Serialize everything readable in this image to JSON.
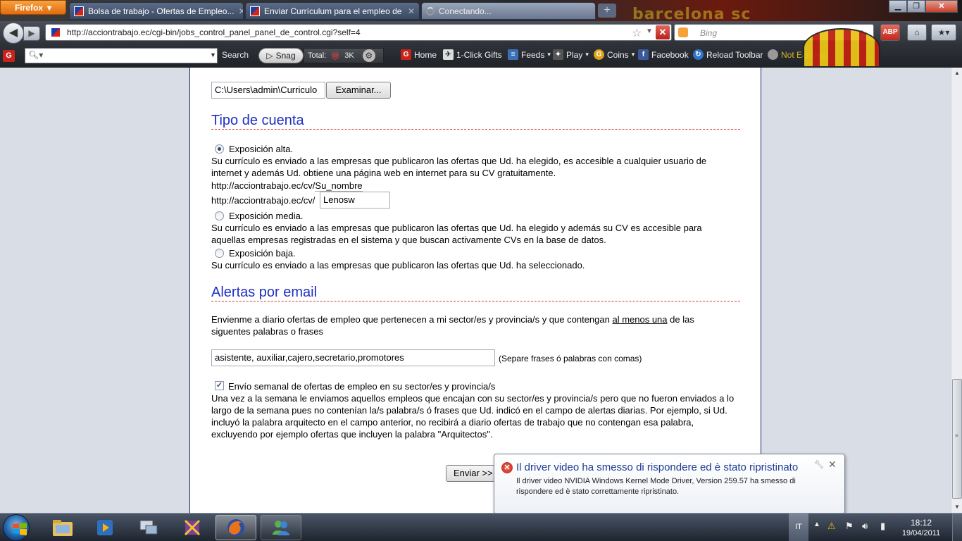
{
  "browser": {
    "menu_button": "Firefox",
    "tabs": [
      {
        "title": "Bolsa de trabajo - Ofertas de Empleo...",
        "state": "inactive"
      },
      {
        "title": "Enviar Currículum para el empleo de",
        "state": "inactive"
      },
      {
        "title": "Conectando...",
        "state": "active"
      }
    ],
    "url": "http://acciontrabajo.ec/cgi-bin/jobs_control_panel_panel_de_control.cgi?self=4",
    "search_placeholder": "Bing",
    "brand_watermark": "barcelona sc"
  },
  "toolbar": {
    "search_label": "Search",
    "snag_label": "Snag",
    "total_label": "Total:",
    "total_count": "3K",
    "items": [
      {
        "label": "Home",
        "icon": "g-icon"
      },
      {
        "label": "1-Click Gifts",
        "icon": "gift-icon"
      },
      {
        "label": "Feeds",
        "icon": "feeds-icon"
      },
      {
        "label": "Play",
        "icon": "play-icon"
      },
      {
        "label": "Coins",
        "icon": "coins-icon"
      },
      {
        "label": "Facebook",
        "icon": "facebook-icon"
      },
      {
        "label": "Reload Toolbar",
        "icon": "reload-icon"
      },
      {
        "label": "Not Earning",
        "icon": "status-icon"
      }
    ]
  },
  "page": {
    "file_path_value": "C:\\Users\\admin\\Curriculo",
    "browse_button": "Examinar...",
    "account_section": {
      "title": "Tipo de cuenta",
      "options": [
        {
          "label": "Exposición alta.",
          "selected": true,
          "description": "Su currículo es enviado a las empresas que publicaron las ofertas que Ud. ha elegido, es accesible a cualquier usuario de internet y además Ud. obtiene una página web en internet para su CV gratuitamente."
        },
        {
          "label": "Exposición media.",
          "selected": false,
          "description": "Su currículo es enviado a las empresas que publicaron las ofertas que Ud. ha elegido y además su CV es accesible para aquellas empresas registradas en el sistema y que buscan activamente CVs en la base de datos."
        },
        {
          "label": "Exposición baja.",
          "selected": false,
          "description": "Su currículo es enviado a las empresas que publicaron las ofertas que Ud. ha seleccionado."
        }
      ],
      "url_hint_prefix": "http://acciontrabajo.ec/cv/",
      "url_hint_suffix": "Su_nombre",
      "url_field_prefix": "http://acciontrabajo.ec/cv/",
      "url_field_value": "Lenosw"
    },
    "alerts_section": {
      "title": "Alertas por email",
      "intro_before_link": "Envienme a diario ofertas de empleo que pertenecen a mi sector/es y provincia/s y que contengan",
      "intro_link": "al menos una",
      "intro_after_link": "de las siguentes palabras o frases",
      "keywords_value": "asistente, auxiliar,cajero,secretario,promotores",
      "keywords_hint": "(Separe frases ó palabras con comas)",
      "weekly_checkbox_label": "Envío semanal de ofertas de empleo en su sector/es y provincia/s",
      "weekly_checked": true,
      "weekly_description": "Una vez a la semana le enviamos aquellos empleos que encajan con su sector/es y provincia/s pero que no fueron enviados a lo largo de la semana pues no contenían la/s palabra/s ó frases que Ud. indicó en el campo de alertas diarias. Por ejemplo, si Ud. incluyó la palabra arquitecto en el campo anterior, no recibirá a diario ofertas de trabajo que no contengan esa palabra, excluyendo por ejemplo ofertas que incluyen la palabra \"Arquitectos\"."
    },
    "submit_button": "Enviar >>"
  },
  "notification": {
    "title": "Il driver video ha smesso di rispondere ed è stato ripristinato",
    "body": "Il driver video NVIDIA Windows Kernel Mode Driver, Version 259.57  ha smesso di rispondere ed è stato correttamente ripristinato."
  },
  "taskbar": {
    "language": "IT",
    "time": "18:12",
    "date": "19/04/2011"
  },
  "colors": {
    "section_title": "#1f2fc2",
    "dashed_rule": "#d23b2b",
    "page_border": "#1a237e",
    "firefox_orange": "#e36b0d"
  }
}
